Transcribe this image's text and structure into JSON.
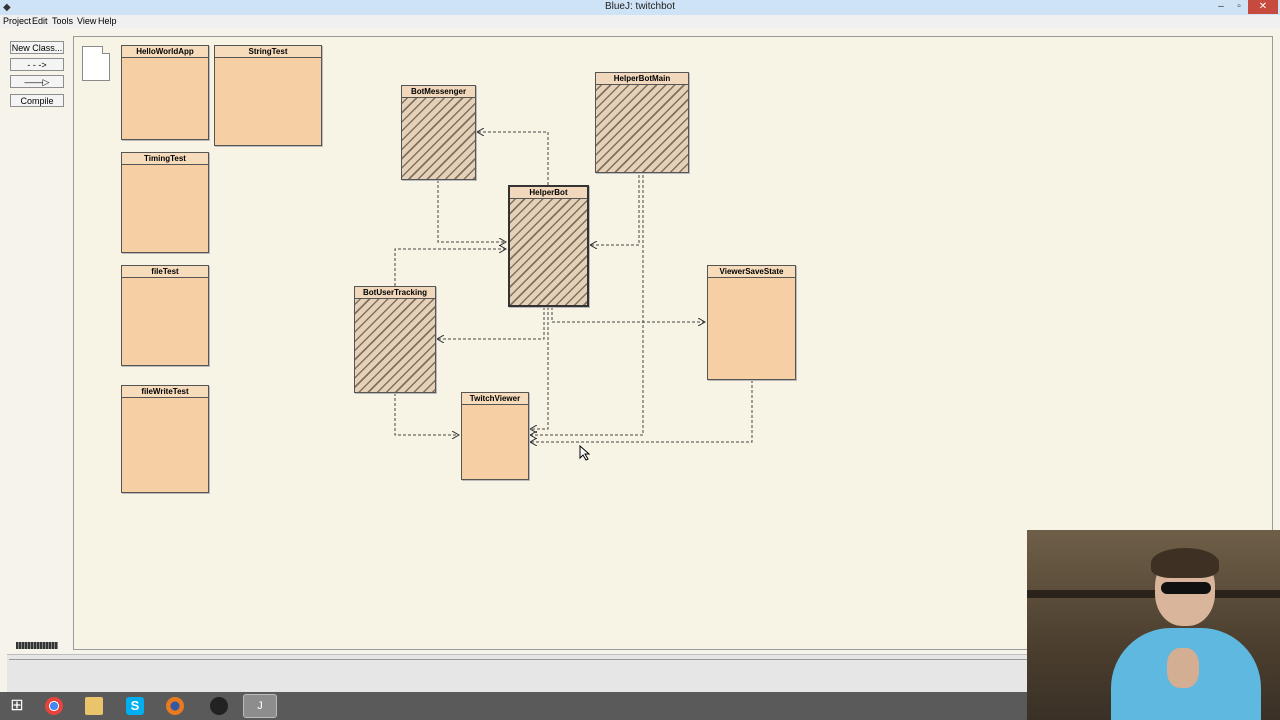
{
  "window": {
    "title": "BlueJ:  twitchbot",
    "app_icon": "bluej-icon",
    "controls": {
      "minimize": "–",
      "maximize": "▫",
      "close": "✕"
    }
  },
  "menu": {
    "items": [
      "Project",
      "Edit",
      "Tools",
      "View",
      "Help"
    ]
  },
  "toolbar": {
    "new_class": "New Class...",
    "uses_arrow": "- - ->",
    "inherit_arrow": "——▷",
    "compile": "Compile"
  },
  "diagram": {
    "readme_icon": "readme-file-icon",
    "classes": [
      {
        "name": "HelloWorldApp",
        "hatched": false
      },
      {
        "name": "StringTest",
        "hatched": false
      },
      {
        "name": "TimingTest",
        "hatched": false
      },
      {
        "name": "fileTest",
        "hatched": false
      },
      {
        "name": "fileWriteTest",
        "hatched": false
      },
      {
        "name": "BotMessenger",
        "hatched": true
      },
      {
        "name": "HelperBotMain",
        "hatched": true
      },
      {
        "name": "HelperBot",
        "hatched": true
      },
      {
        "name": "BotUserTracking",
        "hatched": true
      },
      {
        "name": "TwitchViewer",
        "hatched": false
      },
      {
        "name": "ViewerSaveState",
        "hatched": false
      }
    ]
  },
  "colors": {
    "class_fill": "#f6cfa4",
    "canvas_bg": "#f7f4e5",
    "titlebar": "#cfe3f6"
  },
  "taskbar": {
    "icons": [
      "windows-start-icon",
      "chrome-icon",
      "file-explorer-icon",
      "skype-icon",
      "firefox-icon",
      "obs-icon",
      "bluej-task-icon"
    ],
    "windows_glyph": "⊞",
    "skype_glyph": "S",
    "bluej_glyph": "J"
  }
}
